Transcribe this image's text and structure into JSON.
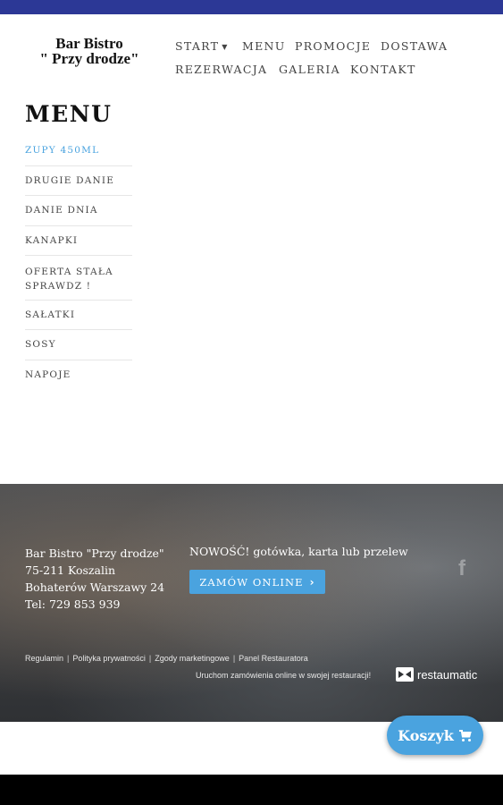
{
  "logo": {
    "line1": "Bar Bistro",
    "line2": "\" Przy drodze\""
  },
  "nav": {
    "items": [
      {
        "label": "START"
      },
      {
        "label": "MENU"
      },
      {
        "label": "PROMOCJE"
      },
      {
        "label": "DOSTAWA"
      },
      {
        "label": "REZERWACJA"
      },
      {
        "label": "GALERIA"
      },
      {
        "label": "KONTAKT"
      }
    ]
  },
  "menu": {
    "title": "MENU",
    "categories": [
      {
        "label": "ZUPY 450ML",
        "active": true
      },
      {
        "label": "DRUGIE DANIE"
      },
      {
        "label": "DANIE DNIA"
      },
      {
        "label": "KANAPKI"
      },
      {
        "label": "OFERTA STAŁA SPRAWDZ !"
      },
      {
        "label": "SAŁATKI"
      },
      {
        "label": "SOSY"
      },
      {
        "label": "NAPOJE"
      }
    ]
  },
  "footer": {
    "address": {
      "name": "Bar Bistro \"Przy drodze\"",
      "city": "75-211 Koszalin",
      "street": "Bohaterów Warszawy 24",
      "phone": "Tel: 729 853 939"
    },
    "promo_text": "NOWOŚĆ! gotówka, karta lub przelew",
    "order_button": "ZAMÓW ONLINE",
    "links": [
      "Regulamin",
      "Polityka prywatności",
      "Zgody marketingowe",
      "Panel Restauratora"
    ],
    "powered_text": "Uruchom zamówienia online w swojej restauracji!",
    "brand": "restaumatic"
  },
  "cart": {
    "label": "Koszyk"
  },
  "colors": {
    "topbar": "#2c3896",
    "accent": "#4aa3df",
    "bottombar": "#000000"
  }
}
